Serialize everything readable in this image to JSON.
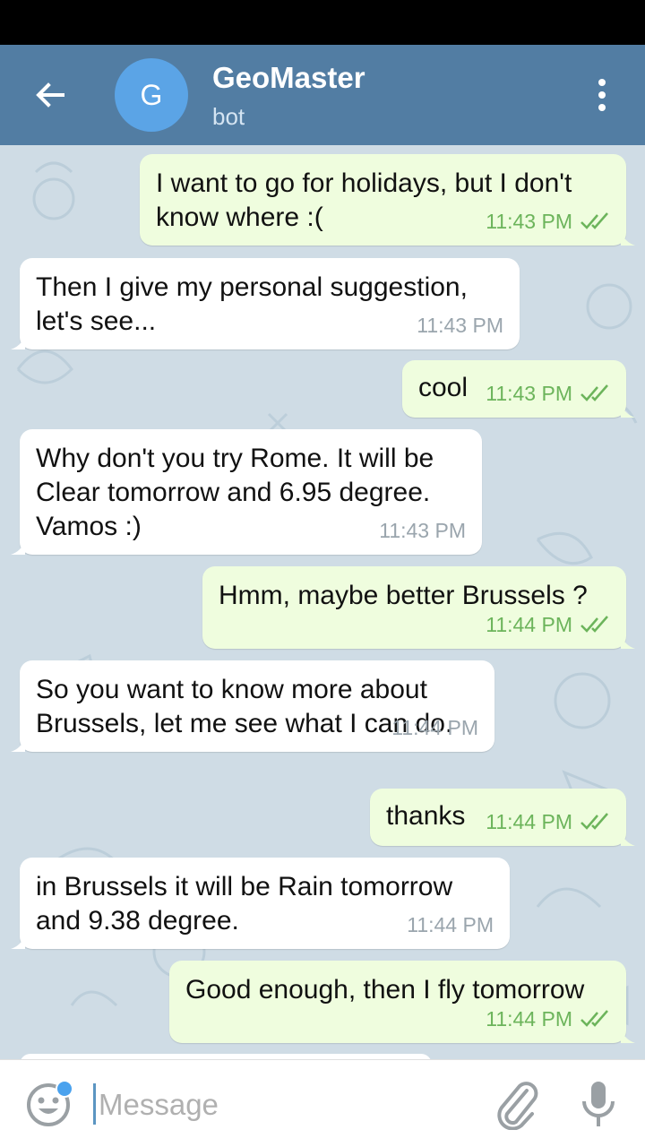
{
  "header": {
    "avatar_letter": "G",
    "title": "GeoMaster",
    "subtitle": "bot"
  },
  "messages": [
    {
      "dir": "out",
      "text": "I want to go for holidays, but I don't know where :(",
      "time": "11:43 PM",
      "read": true
    },
    {
      "dir": "in",
      "text": "Then I give my personal suggestion, let's see...",
      "time": "11:43 PM"
    },
    {
      "dir": "out",
      "text": "cool",
      "time": "11:43 PM",
      "read": true
    },
    {
      "dir": "in",
      "text": "Why don't you try Rome. It will be Clear tomorrow and 6.95 degree. Vamos :)",
      "time": "11:43 PM"
    },
    {
      "dir": "out",
      "text": "Hmm, maybe better Brussels ?",
      "time": "11:44 PM",
      "read": true
    },
    {
      "dir": "in",
      "text": "So you want to know more about Brussels, let me see what I can do.",
      "time": "11:44 PM"
    },
    {
      "dir": "out",
      "text": "thanks",
      "time": "11:44 PM",
      "read": true
    },
    {
      "dir": "in",
      "text": "in Brussels it will be Rain tomorrow and 9.38 degree.",
      "time": "11:44 PM"
    },
    {
      "dir": "out",
      "text": "Good enough, then I fly tomorrow",
      "time": "11:44 PM",
      "read": true
    }
  ],
  "input": {
    "placeholder": "Message"
  },
  "colors": {
    "header": "#527da3",
    "avatar": "#5ba4e6",
    "outgoing_bubble": "#effdde",
    "incoming_bubble": "#ffffff",
    "chat_background": "#cfdce5",
    "check_marks": "#6cb45b"
  }
}
